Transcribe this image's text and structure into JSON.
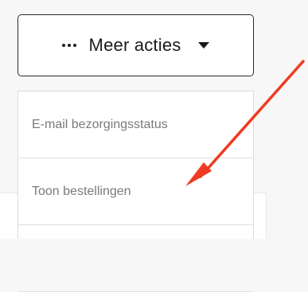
{
  "action_button": {
    "label": "Meer acties"
  },
  "menu": {
    "items": [
      {
        "label": "E-mail bezorgingsstatus"
      },
      {
        "label": "Toon bestellingen"
      },
      {
        "label": ""
      }
    ]
  },
  "colors": {
    "arrow": "#f03a24",
    "button_border": "#2a2a2a",
    "menu_text": "#7a7a7a"
  },
  "icons": {
    "ellipsis": "ellipsis-icon",
    "caret": "caret-down-icon",
    "arrow": "annotation-arrow-icon"
  }
}
